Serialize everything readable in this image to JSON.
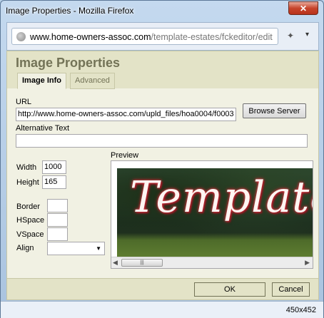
{
  "window": {
    "title": "Image Properties - Mozilla Firefox",
    "close_icon": "✕"
  },
  "address_bar": {
    "host": "www.home-owners-assoc.com",
    "path": "/template-estates/fckeditor/edit",
    "addon_icon": "puzzle-icon",
    "menu_icon": "▾"
  },
  "dialog": {
    "title": "Image Properties",
    "tabs": [
      {
        "label": "Image Info"
      },
      {
        "label": "Advanced"
      }
    ],
    "url_label": "URL",
    "url_value": "http://www.home-owners-assoc.com/upld_files/hoa0004/f0003",
    "browse_button": "Browse Server",
    "alt_label": "Alternative Text",
    "alt_value": "",
    "width_label": "Width",
    "width_value": "1000",
    "height_label": "Height",
    "height_value": "165",
    "border_label": "Border",
    "hspace_label": "HSpace",
    "vspace_label": "VSpace",
    "align_label": "Align",
    "align_value": "",
    "preview_label": "Preview",
    "preview_text": "Template",
    "ok_button": "OK",
    "cancel_button": "Cancel"
  },
  "status": {
    "dimensions": "450x452"
  }
}
